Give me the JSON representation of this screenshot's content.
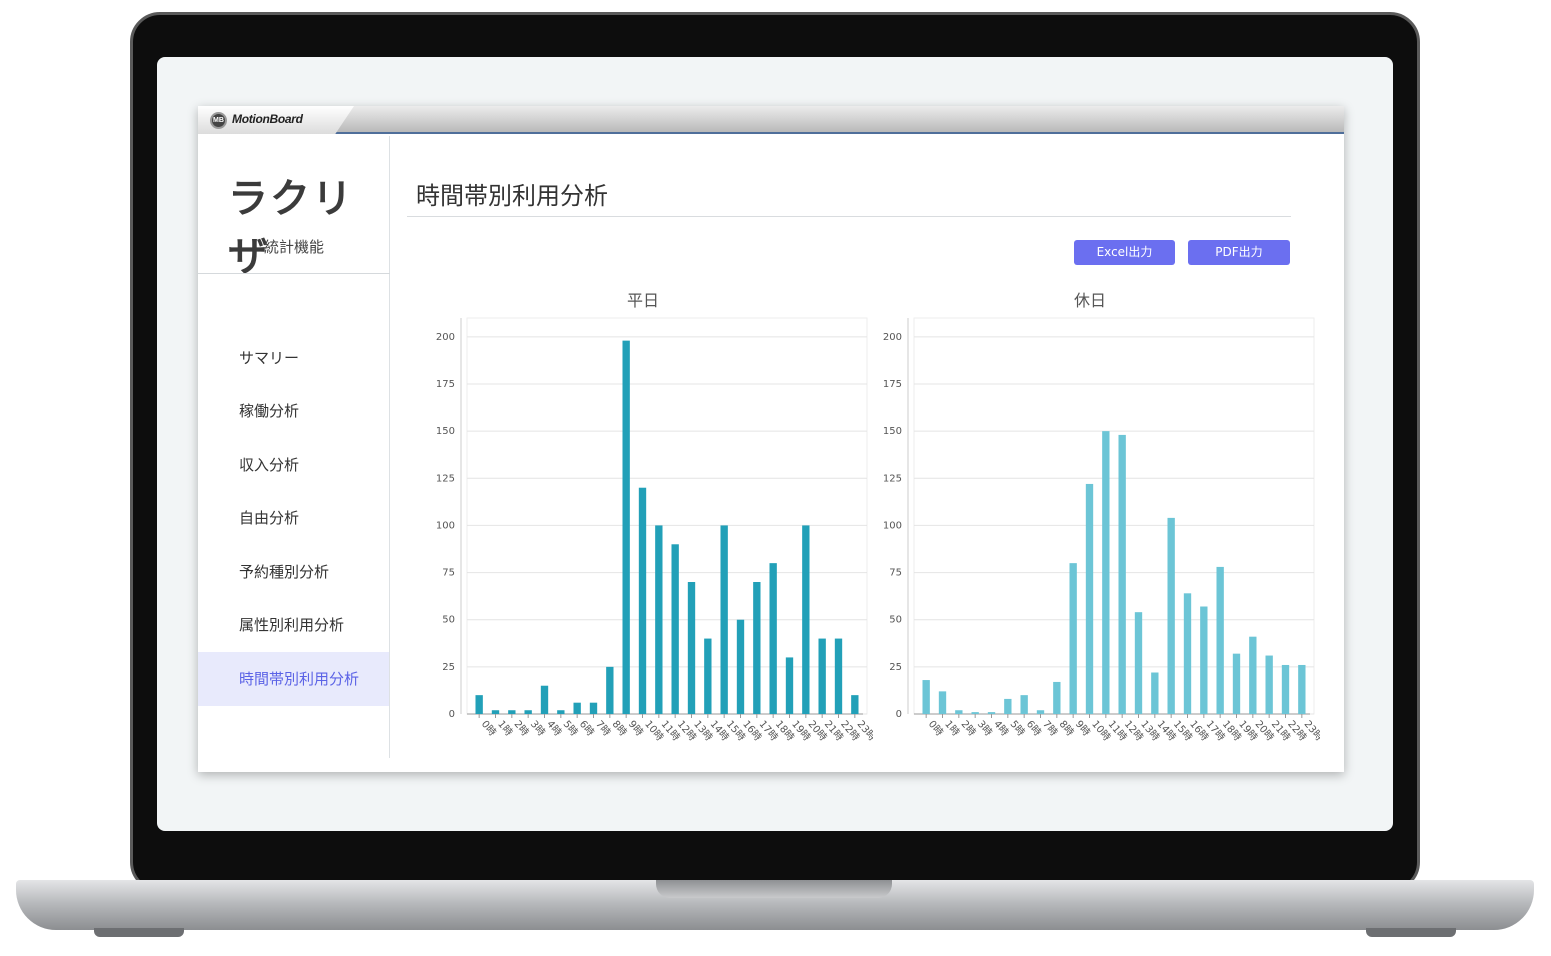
{
  "window": {
    "brand_icon": "MB",
    "brand": "MotionBoard"
  },
  "sidebar": {
    "logo": "ラクリザ",
    "subtitle": "統計機能",
    "items": [
      {
        "label": "サマリー",
        "active": false
      },
      {
        "label": "稼働分析",
        "active": false
      },
      {
        "label": "収入分析",
        "active": false
      },
      {
        "label": "自由分析",
        "active": false
      },
      {
        "label": "予約種別分析",
        "active": false
      },
      {
        "label": "属性別利用分析",
        "active": false
      },
      {
        "label": "時間帯別利用分析",
        "active": true
      }
    ]
  },
  "main": {
    "title": "時間帯別利用分析",
    "buttons": {
      "excel": "Excel出力",
      "pdf": "PDF出力"
    }
  },
  "colors": {
    "accent": "#6b6ff0",
    "weekday_bar": "#22a0b8",
    "holiday_bar": "#6cc5d6",
    "active_nav_bg": "#e8eafc"
  },
  "chart_data": [
    {
      "type": "bar",
      "title": "平日",
      "categories": [
        "0時",
        "1時",
        "2時",
        "3時",
        "4時",
        "5時",
        "6時",
        "7時",
        "8時",
        "9時",
        "10時",
        "11時",
        "12時",
        "13時",
        "14時",
        "15時",
        "16時",
        "17時",
        "18時",
        "19時",
        "20時",
        "21時",
        "22時",
        "23時"
      ],
      "values": [
        10,
        2,
        2,
        2,
        15,
        2,
        6,
        6,
        25,
        198,
        120,
        100,
        90,
        70,
        40,
        100,
        50,
        70,
        80,
        30,
        100,
        40,
        40,
        10
      ],
      "ylim": [
        0,
        210
      ],
      "yticks": [
        0,
        25,
        50,
        75,
        100,
        125,
        150,
        175,
        200
      ],
      "grid": true,
      "color": "#22a0b8"
    },
    {
      "type": "bar",
      "title": "休日",
      "categories": [
        "0時",
        "1時",
        "2時",
        "3時",
        "4時",
        "5時",
        "6時",
        "7時",
        "8時",
        "9時",
        "10時",
        "11時",
        "12時",
        "13時",
        "14時",
        "15時",
        "16時",
        "17時",
        "18時",
        "19時",
        "20時",
        "21時",
        "22時",
        "23時"
      ],
      "values": [
        18,
        12,
        2,
        1,
        1,
        8,
        10,
        2,
        17,
        80,
        122,
        150,
        148,
        54,
        22,
        104,
        64,
        57,
        78,
        32,
        41,
        31,
        26,
        26
      ],
      "ylim": [
        0,
        210
      ],
      "yticks": [
        0,
        25,
        50,
        75,
        100,
        125,
        150,
        175,
        200
      ],
      "grid": true,
      "color": "#6cc5d6"
    }
  ]
}
